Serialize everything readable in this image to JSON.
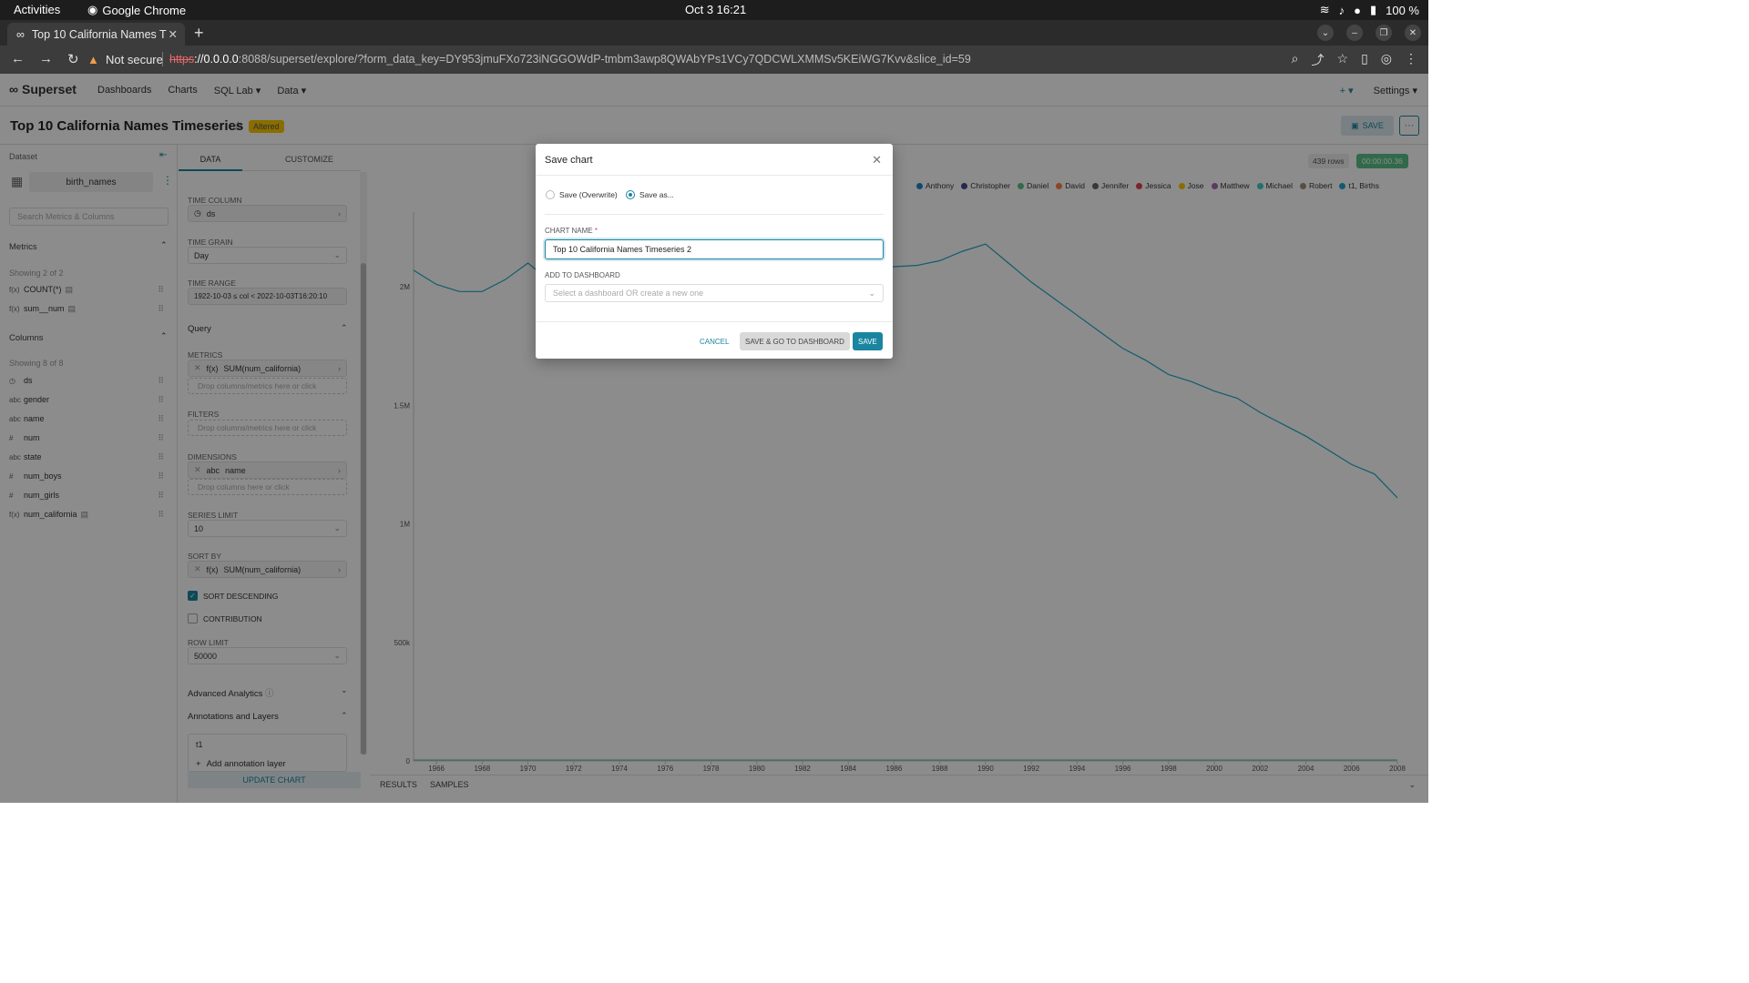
{
  "system": {
    "activities": "Activities",
    "app": "Google Chrome",
    "clock": "Oct 3  16:21",
    "battery": "100 %"
  },
  "browser": {
    "tab_title": "Top 10 California Names T",
    "not_secure": "Not secure",
    "url_proto": "https",
    "url_host": "://0.0.0.0",
    "url_rest": ":8088/superset/explore/?form_data_key=DY953jmuFXo723iNGGOWdP-tmbm3awp8QWAbYPs1VCy7QDCWLXMMSv5KEiWG7Kvv&slice_id=59"
  },
  "superset": {
    "logo": "Superset",
    "menu": [
      "Dashboards",
      "Charts",
      "SQL Lab ▾",
      "Data ▾"
    ],
    "plus": "+ ▾",
    "settings": "Settings ▾"
  },
  "header": {
    "title": "Top 10 California Names Timeseries",
    "badge": "Altered",
    "save": "SAVE",
    "more": "···"
  },
  "dataset": {
    "label": "Dataset",
    "name": "birth_names",
    "search_placeholder": "Search Metrics & Columns",
    "metrics_title": "Metrics",
    "metrics_count": "Showing 2 of 2",
    "metrics": [
      {
        "icon": "f(x)",
        "name": "COUNT(*)"
      },
      {
        "icon": "f(x)",
        "name": "sum__num"
      }
    ],
    "columns_title": "Columns",
    "columns_count": "Showing 8 of 8",
    "columns": [
      {
        "icon": "◷",
        "name": "ds"
      },
      {
        "icon": "abc",
        "name": "gender"
      },
      {
        "icon": "abc",
        "name": "name"
      },
      {
        "icon": "#",
        "name": "num"
      },
      {
        "icon": "abc",
        "name": "state"
      },
      {
        "icon": "#",
        "name": "num_boys"
      },
      {
        "icon": "#",
        "name": "num_girls"
      },
      {
        "icon": "f(x)",
        "name": "num_california"
      }
    ]
  },
  "controls": {
    "tab_data": "DATA",
    "tab_customize": "CUSTOMIZE",
    "time_column_label": "TIME COLUMN",
    "time_column": "ds",
    "time_grain_label": "TIME GRAIN",
    "time_grain": "Day",
    "time_range_label": "TIME RANGE",
    "time_range": "1922-10-03 ≤ col < 2022-10-03T16:20:10",
    "query": "Query",
    "metrics_label": "METRICS",
    "metric": "SUM(num_california)",
    "drop_metrics": "Drop columns/metrics here or click",
    "filters_label": "FILTERS",
    "drop_filters": "Drop columns/metrics here or click",
    "dimensions_label": "DIMENSIONS",
    "dimension": "name",
    "drop_columns": "Drop columns here or click",
    "series_limit_label": "SERIES LIMIT",
    "series_limit": "10",
    "sort_by_label": "SORT BY",
    "sort_by": "SUM(num_california)",
    "sort_desc": "SORT DESCENDING",
    "contribution": "CONTRIBUTION",
    "row_limit_label": "ROW LIMIT",
    "row_limit": "50000",
    "advanced": "Advanced Analytics",
    "annotations": "Annotations and Layers",
    "annotation": "t1",
    "add_annotation": "Add annotation layer",
    "update": "UPDATE CHART"
  },
  "chart_meta": {
    "rows": "439 rows",
    "timer": "00:00:00.36",
    "results": "RESULTS",
    "samples": "SAMPLES"
  },
  "chart_data": {
    "type": "line",
    "legend": [
      {
        "name": "Anthony",
        "color": "#1f86c9"
      },
      {
        "name": "Christopher",
        "color": "#444e8c"
      },
      {
        "name": "Daniel",
        "color": "#5ac189"
      },
      {
        "name": "David",
        "color": "#ff7f44"
      },
      {
        "name": "Jennifer",
        "color": "#666666"
      },
      {
        "name": "Jessica",
        "color": "#e04355"
      },
      {
        "name": "Jose",
        "color": "#fcc700"
      },
      {
        "name": "Matthew",
        "color": "#a868b7"
      },
      {
        "name": "Michael",
        "color": "#3cccca"
      },
      {
        "name": "Robert",
        "color": "#a38f79"
      },
      {
        "name": "t1, Births",
        "color": "#20a7c9"
      }
    ],
    "y_ticks": [
      "2M",
      "1.5M",
      "1M",
      "500k",
      "0"
    ],
    "x_ticks": [
      "1966",
      "1968",
      "1970",
      "1972",
      "1974",
      "1976",
      "1978",
      "1980",
      "1982",
      "1984",
      "1986",
      "1988",
      "1990",
      "1992",
      "1994",
      "1996",
      "1998",
      "2000",
      "2002",
      "2004",
      "2006",
      "2008"
    ],
    "series": [
      {
        "name": "t1, Births",
        "x": [
          1965,
          1966,
          1967,
          1968,
          1969,
          1970,
          1971,
          1972,
          1975,
          1980,
          1983,
          1985,
          1987,
          1988,
          1989,
          1990,
          1991,
          1992,
          1993,
          1994,
          1995,
          1996,
          1997,
          1998,
          1999,
          2000,
          2001,
          2002,
          2003,
          2004,
          2005,
          2006,
          2007,
          2008
        ],
        "values": [
          2070000,
          2010000,
          1980000,
          1980000,
          2030000,
          2100000,
          2020000,
          2130000,
          2150000,
          2140000,
          2140000,
          2080000,
          2090000,
          2110000,
          2150000,
          2180000,
          2100000,
          2020000,
          1950000,
          1880000,
          1810000,
          1740000,
          1690000,
          1630000,
          1600000,
          1560000,
          1530000,
          1470000,
          1420000,
          1370000,
          1310000,
          1250000,
          1210000,
          1110000
        ]
      }
    ],
    "ylim": [
      0,
      2200000
    ]
  },
  "modal": {
    "title": "Save chart",
    "overwrite": "Save (Overwrite)",
    "save_as": "Save as...",
    "chart_name_label": "CHART NAME",
    "required": "*",
    "chart_name": "Top 10 California Names Timeseries 2",
    "dashboard_label": "ADD TO DASHBOARD",
    "dashboard_placeholder": "Select a dashboard OR create a new one",
    "cancel": "CANCEL",
    "save_go": "SAVE & GO TO DASHBOARD",
    "save": "SAVE"
  }
}
